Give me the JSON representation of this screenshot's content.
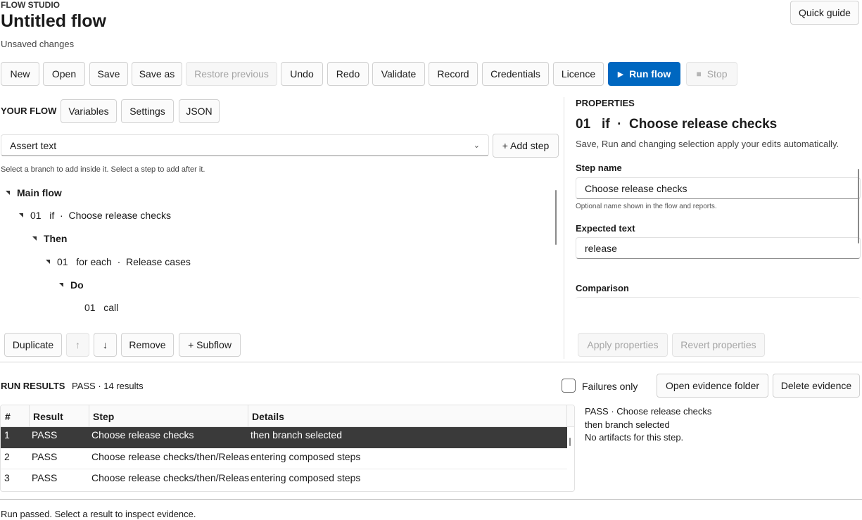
{
  "app": {
    "brand": "FLOW STUDIO",
    "title": "Untitled flow",
    "subtitle": "Unsaved changes",
    "quick_guide": "Quick guide"
  },
  "toolbar": {
    "new": "New",
    "open": "Open",
    "save": "Save",
    "save_as": "Save as",
    "restore_previous": "Restore previous",
    "undo": "Undo",
    "redo": "Redo",
    "validate": "Validate",
    "record": "Record",
    "credentials": "Credentials",
    "licence": "Licence",
    "run_flow": "Run flow",
    "stop": "Stop"
  },
  "flow": {
    "heading": "YOUR FLOW",
    "tabs": {
      "variables": "Variables",
      "settings": "Settings",
      "json": "JSON"
    },
    "step_type_selected": "Assert text",
    "add_step": "+ Add step",
    "hint": "Select a branch to add inside it. Select a step to add after it.",
    "tree": {
      "main": "Main flow",
      "if_step": "01   if  ·  Choose release checks",
      "then": "Then",
      "foreach_step": "01   for each  ·  Release cases",
      "do": "Do",
      "call_step": "01   call"
    },
    "actions": {
      "duplicate": "Duplicate",
      "up": "↑",
      "down": "↓",
      "remove": "Remove",
      "subflow": "+ Subflow"
    }
  },
  "properties": {
    "heading": "PROPERTIES",
    "title": "01   if  ·  Choose release checks",
    "note": "Save, Run and changing selection apply your edits automatically.",
    "step_name_label": "Step name",
    "step_name_value": "Choose release checks",
    "step_name_help": "Optional name shown in the flow and reports.",
    "expected_text_label": "Expected text",
    "expected_text_value": "release",
    "comparison_label": "Comparison",
    "apply": "Apply properties",
    "revert": "Revert properties"
  },
  "results": {
    "heading": "RUN RESULTS",
    "summary": "PASS · 14 results",
    "failures_only": "Failures only",
    "open_evidence": "Open evidence folder",
    "delete_evidence": "Delete evidence",
    "columns": [
      "#",
      "Result",
      "Step",
      "Details"
    ],
    "rows": [
      {
        "num": "1",
        "result": "PASS",
        "step": "Choose release checks",
        "details": "then branch selected"
      },
      {
        "num": "2",
        "result": "PASS",
        "step": "Choose release checks/then/Release",
        "details": "entering composed steps"
      },
      {
        "num": "3",
        "result": "PASS",
        "step": "Choose release checks/then/Release",
        "details": "entering composed steps"
      }
    ],
    "evidence": {
      "line1": "PASS · Choose release checks",
      "line2": "then branch selected",
      "line3": "No artifacts for this step."
    }
  },
  "status_bar": "Run passed. Select a result to inspect evidence.",
  "colors": {
    "accent": "#0067c0",
    "selected_row": "#3a3a3a"
  }
}
